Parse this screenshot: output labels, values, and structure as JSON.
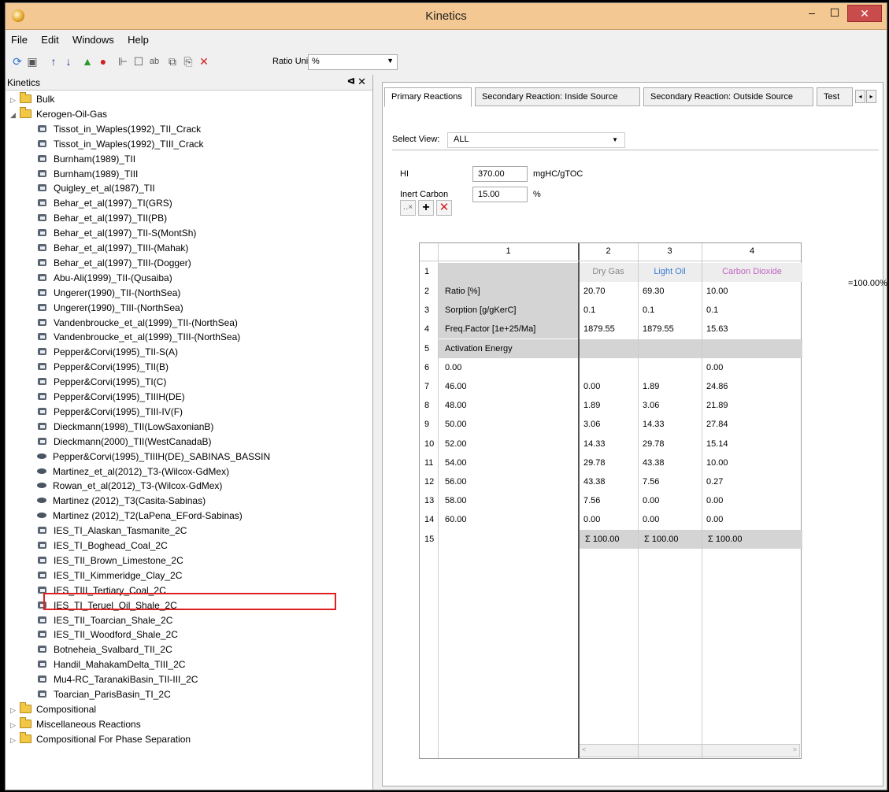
{
  "window": {
    "title": "Kinetics"
  },
  "menu": [
    "File",
    "Edit",
    "Windows",
    "Help"
  ],
  "toolbar": {
    "ratio_label": "Ratio Unit:",
    "ratio_value": "%"
  },
  "left_panel": {
    "title": "Kinetics",
    "pin": "ᗑ",
    "close": "✕",
    "tree": [
      {
        "label": "Bulk",
        "type": "folder",
        "level": 0,
        "expander": "▷"
      },
      {
        "label": "Kerogen-Oil-Gas",
        "type": "folder",
        "level": 0,
        "expander": "◢"
      },
      {
        "label": "Tissot_in_Waples(1992)_TII_Crack",
        "type": "kinetic",
        "level": 1
      },
      {
        "label": "Tissot_in_Waples(1992)_TIII_Crack",
        "type": "kinetic",
        "level": 1
      },
      {
        "label": "Burnham(1989)_TII",
        "type": "kinetic",
        "level": 1
      },
      {
        "label": "Burnham(1989)_TIII",
        "type": "kinetic",
        "level": 1
      },
      {
        "label": "Quigley_et_al(1987)_TII",
        "type": "kinetic",
        "level": 1
      },
      {
        "label": "Behar_et_al(1997)_TI(GRS)",
        "type": "kinetic",
        "level": 1
      },
      {
        "label": "Behar_et_al(1997)_TII(PB)",
        "type": "kinetic",
        "level": 1
      },
      {
        "label": "Behar_et_al(1997)_TII-S(MontSh)",
        "type": "kinetic",
        "level": 1
      },
      {
        "label": "Behar_et_al(1997)_TIII-(Mahak)",
        "type": "kinetic",
        "level": 1
      },
      {
        "label": "Behar_et_al(1997)_TIII-(Dogger)",
        "type": "kinetic",
        "level": 1
      },
      {
        "label": "Abu-Ali(1999)_TII-(Qusaiba)",
        "type": "kinetic",
        "level": 1
      },
      {
        "label": "Ungerer(1990)_TII-(NorthSea)",
        "type": "kinetic",
        "level": 1
      },
      {
        "label": "Ungerer(1990)_TIII-(NorthSea)",
        "type": "kinetic",
        "level": 1
      },
      {
        "label": "Vandenbroucke_et_al(1999)_TII-(NorthSea)",
        "type": "kinetic",
        "level": 1
      },
      {
        "label": "Vandenbroucke_et_al(1999)_TIII-(NorthSea)",
        "type": "kinetic",
        "level": 1
      },
      {
        "label": "Pepper&Corvi(1995)_TII-S(A)",
        "type": "kinetic",
        "level": 1
      },
      {
        "label": "Pepper&Corvi(1995)_TII(B)",
        "type": "kinetic",
        "level": 1
      },
      {
        "label": "Pepper&Corvi(1995)_TI(C)",
        "type": "kinetic",
        "level": 1
      },
      {
        "label": "Pepper&Corvi(1995)_TIIIH(DE)",
        "type": "kinetic",
        "level": 1
      },
      {
        "label": "Pepper&Corvi(1995)_TIII-IV(F)",
        "type": "kinetic",
        "level": 1
      },
      {
        "label": "Dieckmann(1998)_TII(LowSaxonianB)",
        "type": "kinetic",
        "level": 1
      },
      {
        "label": "Dieckmann(2000)_TII(WestCanadaB)",
        "type": "kinetic",
        "level": 1
      },
      {
        "label": "Pepper&Corvi(1995)_TIIIH(DE)_SABINAS_BASSIN",
        "type": "dot",
        "level": 1
      },
      {
        "label": "Martinez_et_al(2012)_T3-(Wilcox-GdMex)",
        "type": "dot",
        "level": 1
      },
      {
        "label": "Rowan_et_al(2012)_T3-(Wilcox-GdMex)",
        "type": "dot",
        "level": 1
      },
      {
        "label": "Martinez (2012)_T3(Casita-Sabinas)",
        "type": "dot",
        "level": 1
      },
      {
        "label": "Martinez (2012)_T2(LaPena_EFord-Sabinas)",
        "type": "dot",
        "level": 1
      },
      {
        "label": "IES_TI_Alaskan_Tasmanite_2C",
        "type": "kinetic",
        "level": 1
      },
      {
        "label": "IES_TI_Boghead_Coal_2C",
        "type": "kinetic",
        "level": 1
      },
      {
        "label": "IES_TII_Brown_Limestone_2C",
        "type": "kinetic",
        "level": 1
      },
      {
        "label": "IES_TII_Kimmeridge_Clay_2C",
        "type": "kinetic",
        "level": 1
      },
      {
        "label": "IES_TIII_Tertiary_Coal_2C",
        "type": "kinetic",
        "level": 1
      },
      {
        "label": "IES_TI_Teruel_Oil_Shale_2C",
        "type": "kinetic",
        "level": 1
      },
      {
        "label": "IES_TII_Toarcian_Shale_2C",
        "type": "kinetic",
        "level": 1
      },
      {
        "label": "IES_TII_Woodford_Shale_2C",
        "type": "kinetic",
        "level": 1
      },
      {
        "label": "Botneheia_Svalbard_TII_2C",
        "type": "kinetic",
        "level": 1
      },
      {
        "label": "Handil_MahakamDelta_TIII_2C",
        "type": "kinetic",
        "level": 1
      },
      {
        "label": "Mu4-RC_TaranakiBasin_TII-III_2C",
        "type": "kinetic",
        "level": 1
      },
      {
        "label": "Toarcian_ParisBasin_TI_2C",
        "type": "kinetic",
        "level": 1
      },
      {
        "label": "Compositional",
        "type": "folder",
        "level": 0,
        "expander": "▷"
      },
      {
        "label": "Miscellaneous Reactions",
        "type": "folder",
        "level": 0,
        "expander": "▷"
      },
      {
        "label": "Compositional For Phase Separation",
        "type": "folder",
        "level": 0,
        "expander": "▷"
      }
    ]
  },
  "tabs": [
    "Primary Reactions",
    "Secondary Reaction: Inside Source",
    "Secondary Reaction: Outside Source",
    "Test"
  ],
  "select_view": {
    "label": "Select View:",
    "value": "ALL"
  },
  "fields": {
    "hi_label": "HI",
    "hi_value": "370.00",
    "hi_unit": "mgHC/gTOC",
    "inert_label": "Inert Carbon",
    "inert_value": "15.00",
    "inert_unit": "%"
  },
  "grid": {
    "col_headers": [
      "1",
      "2",
      "3",
      "4"
    ],
    "species": [
      "Dry Gas",
      "Light Oil",
      "Carbon Dioxide"
    ],
    "species_colors": [
      "#888888",
      "#3a7bd5",
      "#c064c0"
    ],
    "param_rows": [
      {
        "label": "Ratio [%]",
        "values": [
          "20.70",
          "69.30",
          "10.00"
        ]
      },
      {
        "label": "Sorption [g/gKerC]",
        "values": [
          "0.1",
          "0.1",
          "0.1"
        ]
      },
      {
        "label": "Freq.Factor [1e+25/Ma]",
        "values": [
          "1879.55",
          "1879.55",
          "15.63"
        ]
      },
      {
        "label": "Activation Energy",
        "values": [
          "",
          "",
          ""
        ]
      }
    ],
    "energy_rows": [
      {
        "label": "0.00",
        "values": [
          "",
          "",
          "0.00"
        ]
      },
      {
        "label": "46.00",
        "values": [
          "0.00",
          "1.89",
          "24.86"
        ]
      },
      {
        "label": "48.00",
        "values": [
          "1.89",
          "3.06",
          "21.89"
        ]
      },
      {
        "label": "50.00",
        "values": [
          "3.06",
          "14.33",
          "27.84"
        ]
      },
      {
        "label": "52.00",
        "values": [
          "14.33",
          "29.78",
          "15.14"
        ]
      },
      {
        "label": "54.00",
        "values": [
          "29.78",
          "43.38",
          "10.00"
        ]
      },
      {
        "label": "56.00",
        "values": [
          "43.38",
          "7.56",
          "0.27"
        ]
      },
      {
        "label": "58.00",
        "values": [
          "7.56",
          "0.00",
          "0.00"
        ]
      },
      {
        "label": "60.00",
        "values": [
          "0.00",
          "0.00",
          "0.00"
        ]
      }
    ],
    "sums": [
      "Σ 100.00",
      "Σ 100.00",
      "Σ 100.00"
    ],
    "total": "=100.00%"
  }
}
